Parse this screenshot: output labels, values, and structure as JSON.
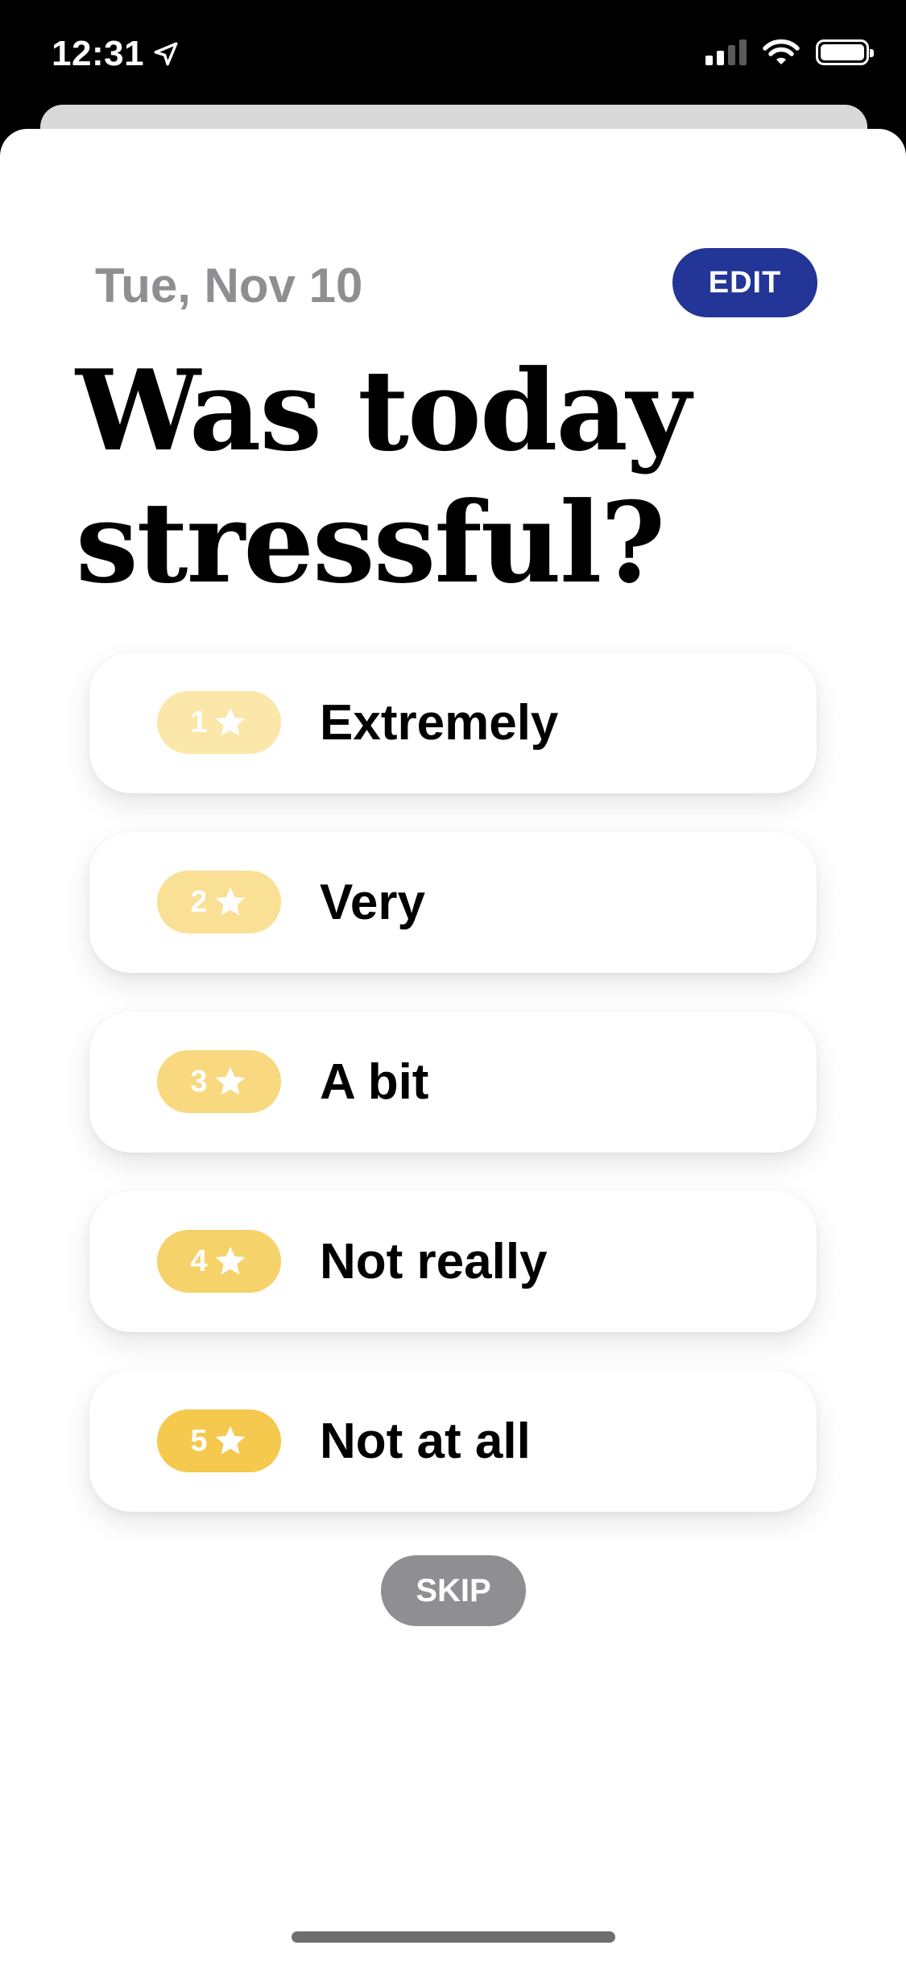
{
  "status_bar": {
    "time": "12:31"
  },
  "header": {
    "date": "Tue, Nov 10",
    "edit_label": "EDIT"
  },
  "question": {
    "title": "Was today stressful?"
  },
  "options": [
    {
      "number": "1",
      "label": "Extremely",
      "color": "#FBE7A9"
    },
    {
      "number": "2",
      "label": "Very",
      "color": "#F9E095"
    },
    {
      "number": "3",
      "label": "A bit",
      "color": "#F8D97F"
    },
    {
      "number": "4",
      "label": "Not really",
      "color": "#F6D26A"
    },
    {
      "number": "5",
      "label": "Not at all",
      "color": "#F4C94E"
    }
  ],
  "footer": {
    "skip_label": "SKIP"
  },
  "colors": {
    "accent": "#233596",
    "secondary_text": "#8E8E93"
  }
}
